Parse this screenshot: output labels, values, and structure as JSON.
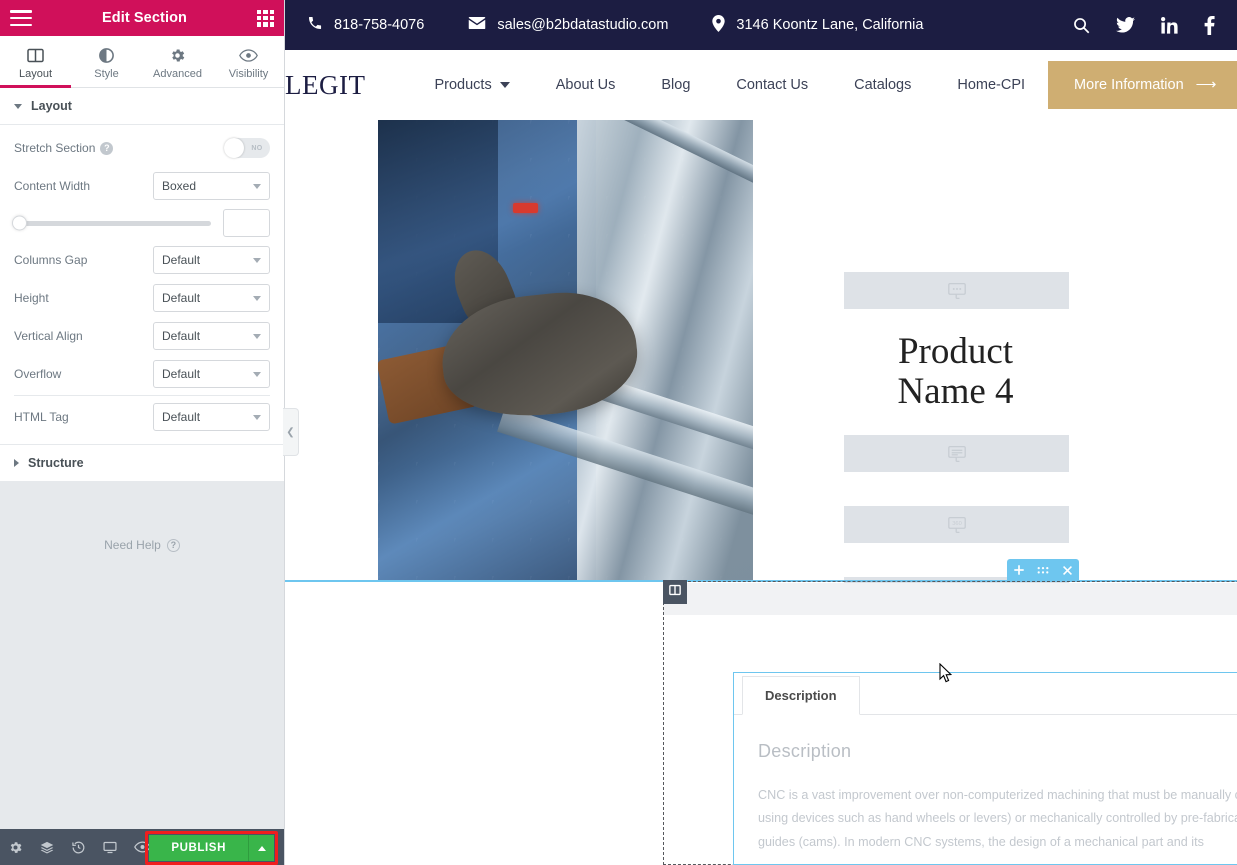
{
  "panel": {
    "title": "Edit Section",
    "menu_icon": "hamburger-icon",
    "grid_icon": "widgets-grid-icon",
    "tabs": [
      {
        "label": "Layout",
        "icon": "layout-columns-icon",
        "active": true
      },
      {
        "label": "Style",
        "icon": "contrast-circle-icon",
        "active": false
      },
      {
        "label": "Advanced",
        "icon": "gear-icon",
        "active": false
      },
      {
        "label": "Visibility",
        "icon": "eye-icon",
        "active": false
      }
    ],
    "sections": [
      {
        "label": "Layout",
        "expanded": true
      },
      {
        "label": "Structure",
        "expanded": false
      }
    ],
    "controls": {
      "stretch_section": {
        "label": "Stretch Section",
        "value": "NO",
        "help": "?"
      },
      "content_width": {
        "label": "Content Width",
        "value": "Boxed"
      },
      "width_slider": {
        "value": "",
        "position_pct": 0
      },
      "columns_gap": {
        "label": "Columns Gap",
        "value": "Default"
      },
      "height": {
        "label": "Height",
        "value": "Default"
      },
      "vertical_align": {
        "label": "Vertical Align",
        "value": "Default"
      },
      "overflow": {
        "label": "Overflow",
        "value": "Default"
      },
      "html_tag": {
        "label": "HTML Tag",
        "value": "Default"
      }
    },
    "need_help": "Need Help",
    "footer": {
      "icons": [
        "settings-gear-icon",
        "navigator-layers-icon",
        "history-clock-icon",
        "responsive-monitor-icon",
        "preview-eye-icon"
      ],
      "publish_label": "PUBLISH",
      "publish_color": "#39b54a",
      "highlight_color": "#f01e1e"
    },
    "accent_color": "#d0105a",
    "collapse_handle": "chevron-left-icon"
  },
  "site": {
    "topbar": {
      "phone": "818-758-4076",
      "email": "sales@b2bdatastudio.com",
      "address": "3146 Koontz Lane, California",
      "social": [
        "search-icon",
        "twitter-icon",
        "linkedin-icon",
        "facebook-icon"
      ],
      "bg_color": "#1c1d42"
    },
    "nav": {
      "brand": "LEGIT",
      "links": [
        {
          "label": "Products",
          "has_dropdown": true
        },
        {
          "label": "About Us",
          "has_dropdown": false
        },
        {
          "label": "Blog",
          "has_dropdown": false
        },
        {
          "label": "Contact Us",
          "has_dropdown": false
        },
        {
          "label": "Catalogs",
          "has_dropdown": false
        },
        {
          "label": "Home-CPI",
          "has_dropdown": false
        }
      ],
      "cta": {
        "label": "More Information",
        "icon": "arrow-right-icon",
        "color": "#cfae72"
      }
    },
    "product": {
      "name": "Product\nName 4",
      "placeholders": [
        {
          "icon": "badge-dots-icon"
        },
        {
          "icon": "badge-lines-icon"
        },
        {
          "icon": "badge-360-icon"
        },
        {
          "icon": "badge-zoom-in-icon"
        }
      ]
    },
    "tabs_widget": {
      "tabs": [
        {
          "label": "Description",
          "active": true
        }
      ],
      "heading": "Description",
      "body": "CNC is a vast improvement over non-computerized machining that must be manually controlled (e.g. using devices such as hand wheels or levers) or mechanically controlled by pre-fabricated pattern guides (cams). In modern CNC systems, the design of a mechanical part and its",
      "edit_icon": "pencil-edit-icon"
    },
    "editor_overlay": {
      "section_tab_icons": [
        "add-section-icon",
        "drag-handle-icon",
        "close-icon"
      ],
      "column_handle_icon": "column-icon",
      "highlight_color": "#6ec6ef"
    }
  }
}
